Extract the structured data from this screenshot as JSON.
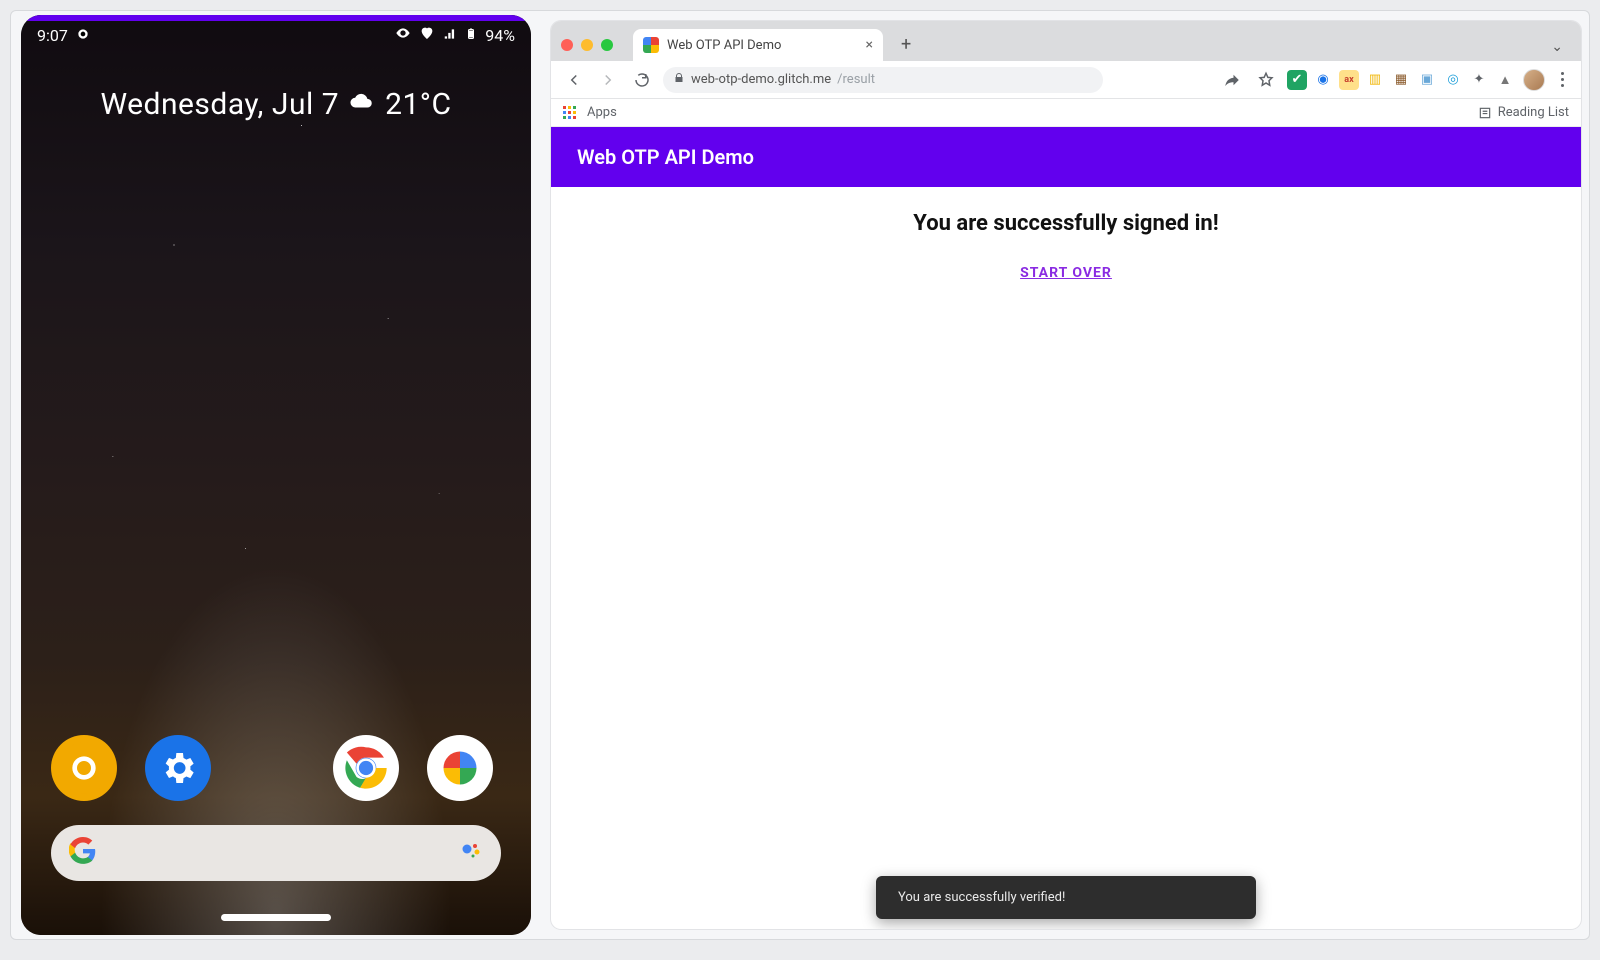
{
  "phone": {
    "status": {
      "time": "9:07",
      "battery": "94%"
    },
    "widget": {
      "date": "Wednesday, Jul 7",
      "temp": "21°C"
    },
    "dock_icons": [
      "chrome-canary",
      "settings",
      "",
      "chrome",
      "photos"
    ]
  },
  "browser": {
    "traffic_lights": [
      "#ff5f57",
      "#febc2e",
      "#28c840"
    ],
    "tab": {
      "title": "Web OTP API Demo"
    },
    "url": {
      "host": "web-otp-demo.glitch.me",
      "path": "/result"
    },
    "bookmarks": {
      "apps_label": "Apps",
      "reading_list_label": "Reading List"
    },
    "page": {
      "header_title": "Web OTP API Demo",
      "heading": "You are successfully signed in!",
      "cta": "START OVER"
    },
    "toast": "You are successfully verified!"
  },
  "extension_colors": [
    "#1fa463",
    "#1a73e8",
    "#c7402d",
    "#f0b400",
    "#8a5a2b",
    "#6aa8d8",
    "#1a9dd9",
    "#4b4b4b",
    "#777777"
  ]
}
